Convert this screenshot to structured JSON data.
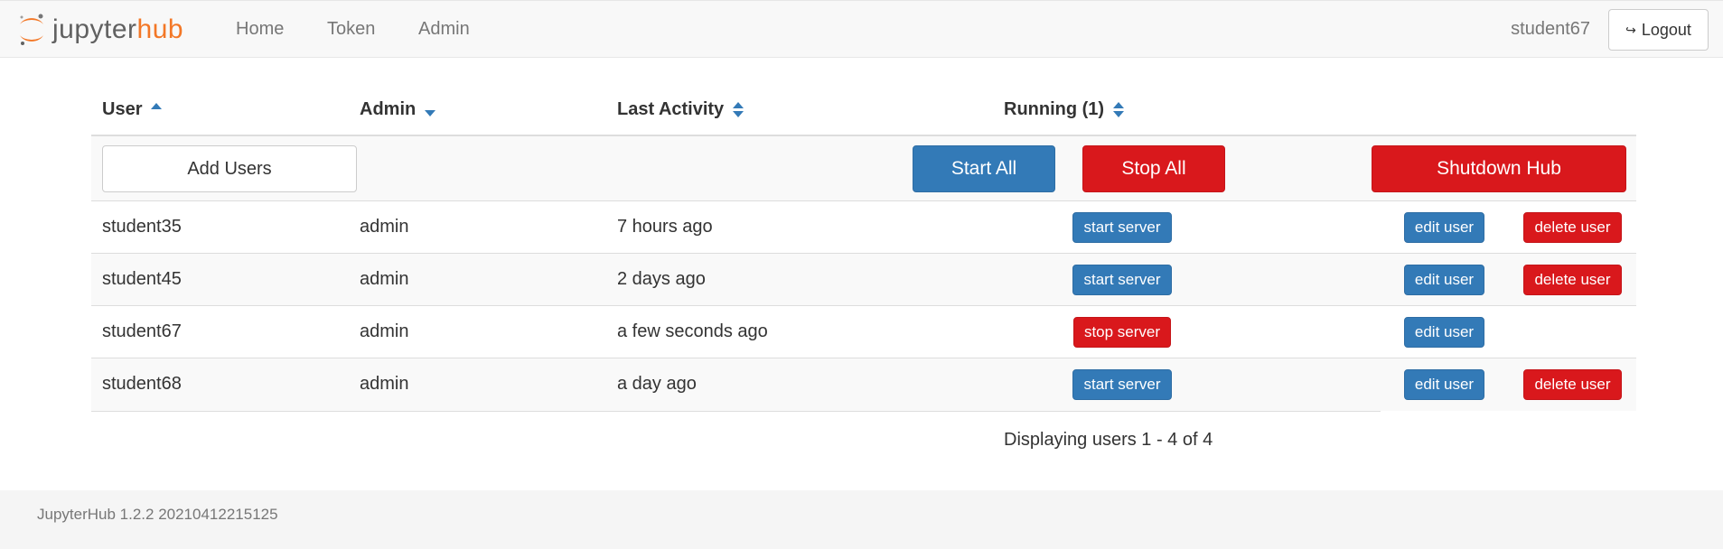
{
  "nav": {
    "logo_left": "jupyter",
    "logo_right": "hub",
    "links": [
      "Home",
      "Token",
      "Admin"
    ],
    "user": "student67",
    "logout": "Logout"
  },
  "table": {
    "headers": {
      "user": "User",
      "admin": "Admin",
      "last_activity": "Last Activity",
      "running": "Running (1)"
    },
    "actions": {
      "add_users": "Add Users",
      "start_all": "Start All",
      "stop_all": "Stop All",
      "shutdown_hub": "Shutdown Hub"
    },
    "rows": [
      {
        "user": "student35",
        "admin": "admin",
        "last_activity": "7 hours ago",
        "server_btn": "start server",
        "edit": "edit user",
        "delete": "delete user"
      },
      {
        "user": "student45",
        "admin": "admin",
        "last_activity": "2 days ago",
        "server_btn": "start server",
        "edit": "edit user",
        "delete": "delete user"
      },
      {
        "user": "student67",
        "admin": "admin",
        "last_activity": "a few seconds ago",
        "server_btn": "stop server",
        "edit": "edit user"
      },
      {
        "user": "student68",
        "admin": "admin",
        "last_activity": "a day ago",
        "server_btn": "start server",
        "edit": "edit user",
        "delete": "delete user"
      }
    ],
    "pager": "Displaying users 1 - 4 of 4"
  },
  "footer": "JupyterHub 1.2.2 20210412215125",
  "colors": {
    "brand": "#f37726",
    "primary": "#337ab7",
    "danger": "#d9181c"
  }
}
